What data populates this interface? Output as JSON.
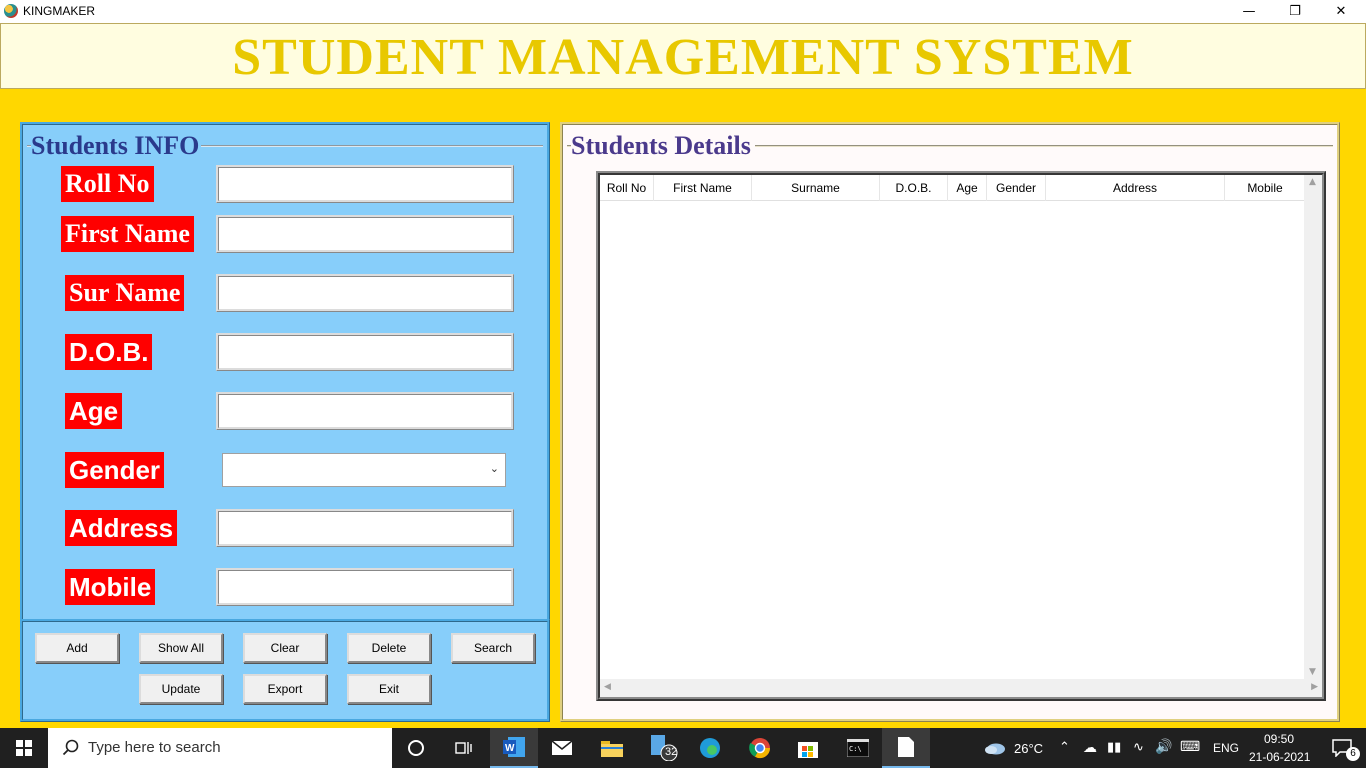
{
  "window": {
    "title": "KINGMAKER",
    "minimize_glyph": "—",
    "restore_glyph": "❐",
    "close_glyph": "✕"
  },
  "header": {
    "title": "STUDENT MANAGEMENT SYSTEM"
  },
  "students_info": {
    "title": "Students INFO",
    "fields": {
      "roll_no": {
        "label": "Roll No",
        "value": ""
      },
      "first_name": {
        "label": "First Name",
        "value": ""
      },
      "sur_name": {
        "label": "Sur Name",
        "value": ""
      },
      "dob": {
        "label": "D.O.B.",
        "value": ""
      },
      "age": {
        "label": "Age",
        "value": ""
      },
      "gender": {
        "label": "Gender",
        "value": ""
      },
      "address": {
        "label": "Address",
        "value": ""
      },
      "mobile": {
        "label": "Mobile",
        "value": ""
      }
    },
    "buttons": {
      "add": "Add",
      "show_all": "Show All",
      "clear": "Clear",
      "delete": "Delete",
      "search": "Search",
      "update": "Update",
      "export": "Export",
      "exit": "Exit"
    }
  },
  "students_details": {
    "title": "Students Details",
    "columns": [
      "Roll No",
      "First Name",
      "Surname",
      "D.O.B.",
      "Age",
      "Gender",
      "Address",
      "Mobile"
    ],
    "rows": []
  },
  "taskbar": {
    "search_placeholder": "Type here to search",
    "icons": [
      "windows-start-icon",
      "search-icon",
      "cortana-icon",
      "task-view-icon",
      "word-icon",
      "mail-icon",
      "file-explorer-icon",
      "calendar-icon",
      "edge-icon",
      "chrome-icon",
      "store-icon",
      "terminal-icon",
      "document-icon"
    ],
    "badge_count": "32",
    "weather": "26°C",
    "language": "ENG",
    "time": "09:50",
    "date": "21-06-2021",
    "notification_count": "6"
  },
  "colors": {
    "background": "#FFD700",
    "header_title": "#E8C800",
    "panel_left": "#87CEFA",
    "label_bg": "#FF0000",
    "left_title": "#2A3A8C",
    "right_title": "#4B3A8C"
  }
}
